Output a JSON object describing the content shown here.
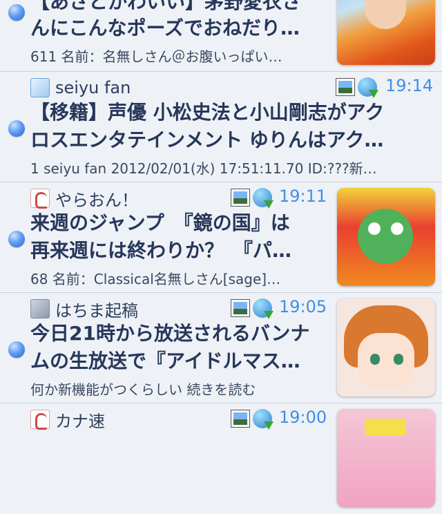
{
  "feed": [
    {
      "source": "",
      "time": "",
      "title_line1": "【あさとかわいい】茅野愛衣さ",
      "title_line2": "んにこんなポーズでおねだり…",
      "subtitle": "611 名前：名無しさん＠お腹いっぱい…",
      "has_thumb": true
    },
    {
      "source": "seiyu fan",
      "time": "19:14",
      "title_line1": "【移籍】声優 小松史法と小山剛志がアク",
      "title_line2": "ロスエンタテインメント ゆりんはアク…",
      "subtitle": "1 seiyu fan 2012/02/01(水) 17:51:11.70 ID:???新…",
      "has_thumb": false
    },
    {
      "source": "やらおん！",
      "time": "19:11",
      "title_line1": "来週のジャンプ　『鏡の国』は",
      "title_line2": "再来週には終わりか？　『パ…",
      "subtitle": "68 名前：Classical名無しさん[sage]…",
      "has_thumb": true
    },
    {
      "source": "はちま起稿",
      "time": "19:05",
      "title_line1": "今日21時から放送されるバンナ",
      "title_line2": "ムの生放送で『アイドルマス…",
      "subtitle": "何か新機能がつくらしい 続きを読む",
      "has_thumb": true
    },
    {
      "source": "カナ速",
      "time": "19:00",
      "title_line1": "",
      "title_line2": "",
      "subtitle": "",
      "has_thumb": true
    }
  ],
  "icons": {
    "unread": "unread-dot-icon",
    "image": "image-icon",
    "download": "download-icon"
  },
  "colors": {
    "time": "#3f8ee8",
    "background": "#eef1f6",
    "title": "#26375a"
  }
}
